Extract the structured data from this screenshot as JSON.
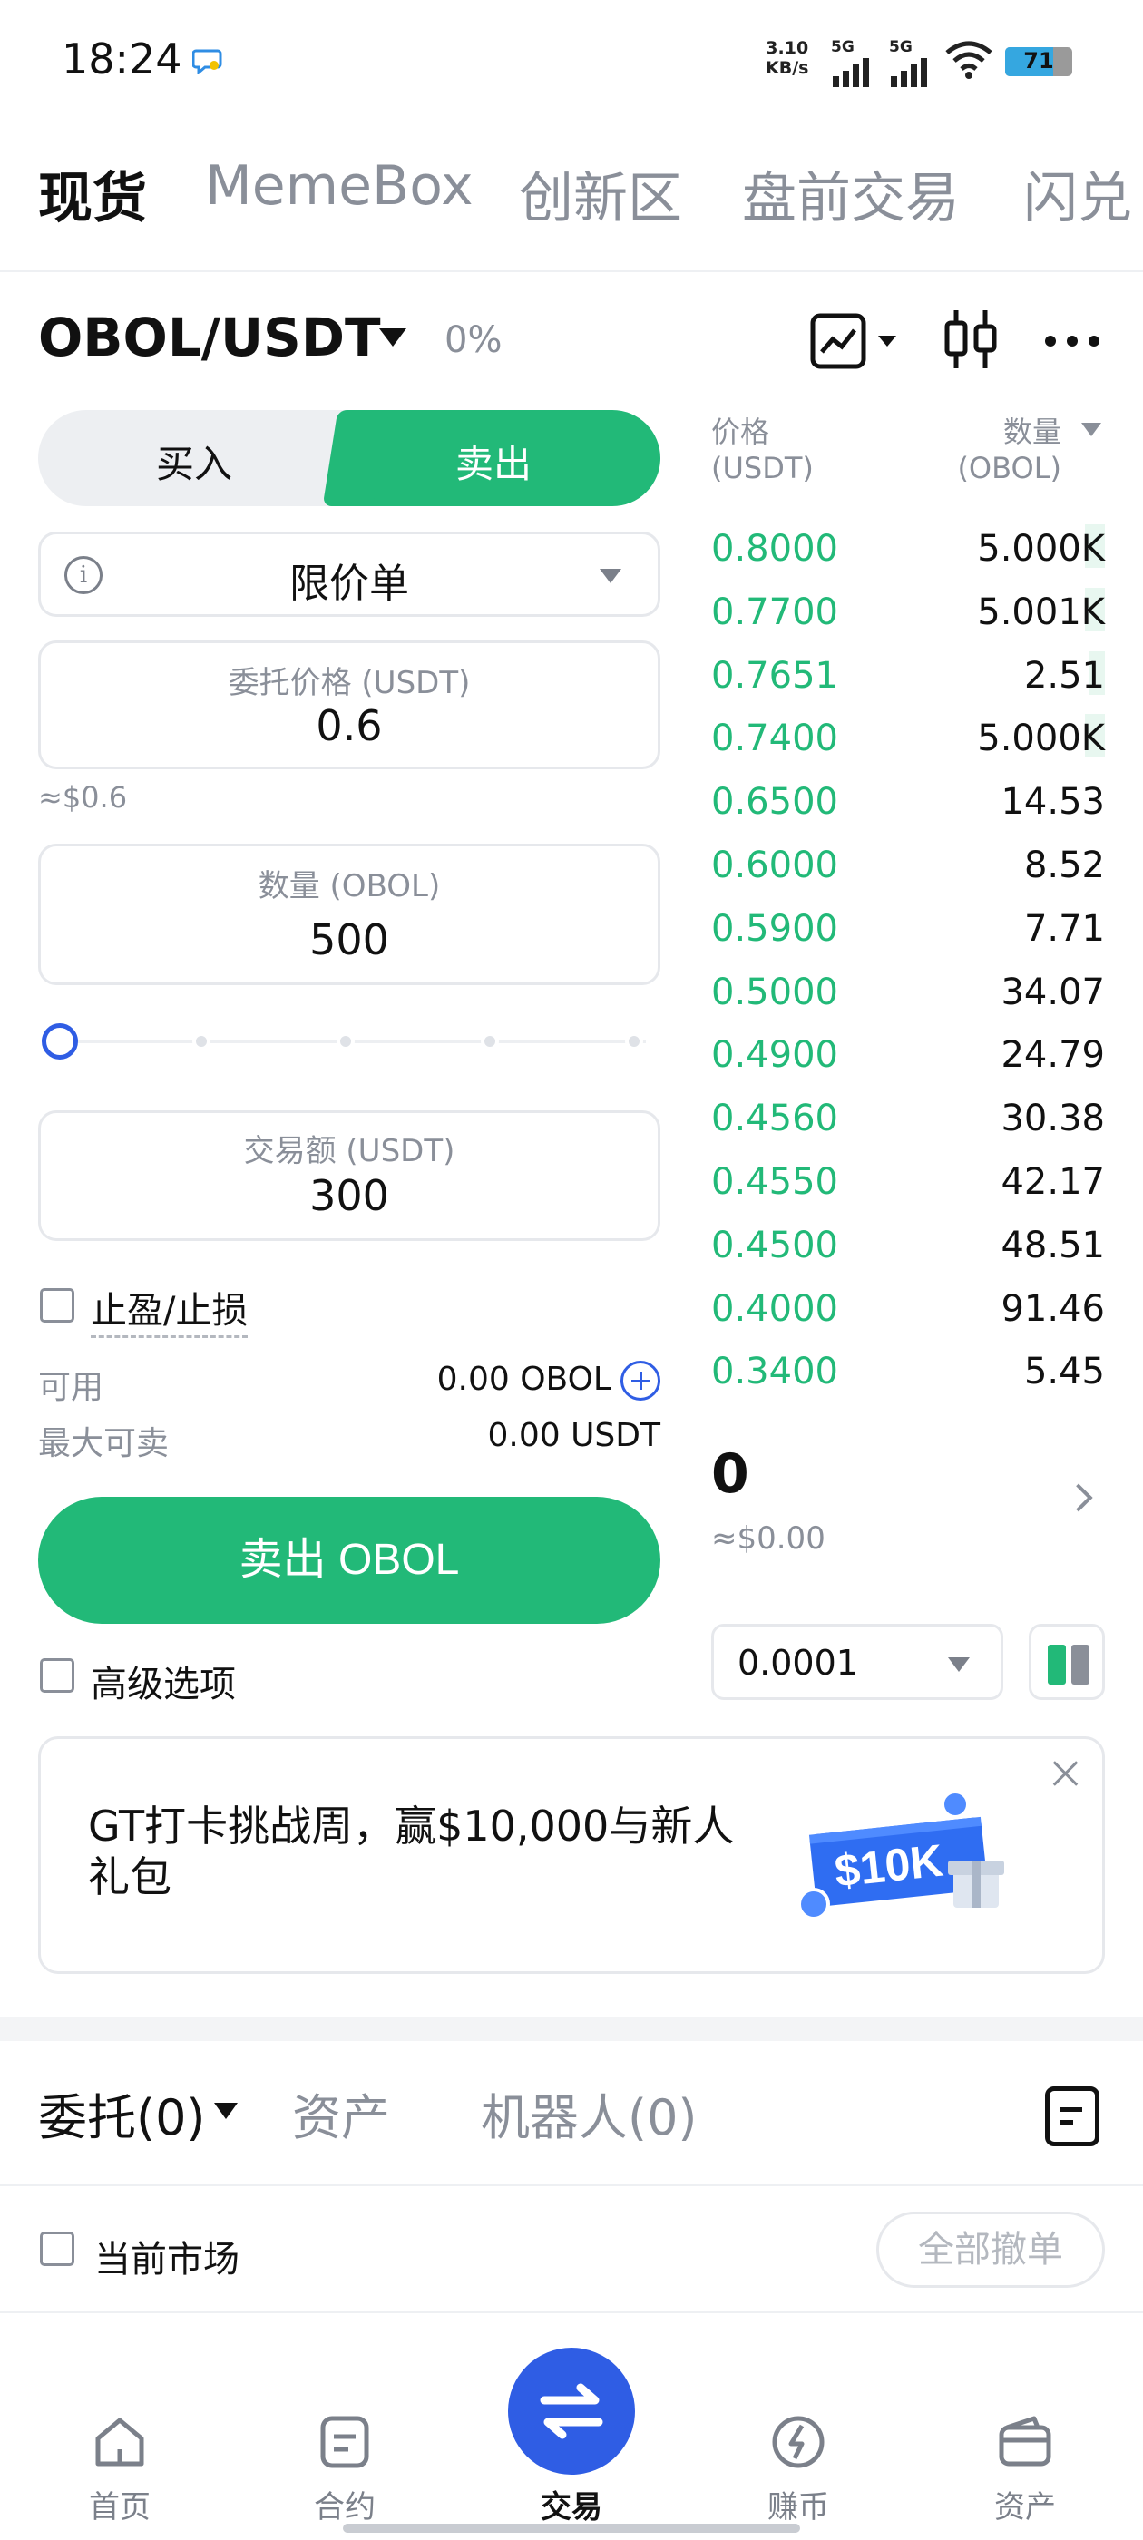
{
  "status_bar": {
    "time": "18:24",
    "net_speed_value": "3.10",
    "net_speed_unit": "KB/s",
    "sim1_label": "5G",
    "sim2_label": "5G",
    "battery": "71",
    "icons": [
      "chat-bubble-icon",
      "signal-icon",
      "wifi-icon",
      "battery-icon"
    ]
  },
  "top_tabs": [
    {
      "label": "现货",
      "active": true
    },
    {
      "label": "MemeBox",
      "active": false
    },
    {
      "label": "创新区",
      "active": false
    },
    {
      "label": "盘前交易",
      "active": false
    },
    {
      "label": "闪兑",
      "active": false
    }
  ],
  "pair": {
    "symbol": "OBOL/USDT",
    "change": "0%",
    "icons": [
      "chart-icon",
      "candlestick-icon",
      "more-icon"
    ]
  },
  "toggle": {
    "buy": "买入",
    "sell": "卖出",
    "selected": "sell"
  },
  "form": {
    "order_type": "限价单",
    "price_label": "委托价格 (USDT)",
    "price_value": "0.6",
    "price_approx": "≈$0.6",
    "qty_label": "数量 (OBOL)",
    "qty_value": "500",
    "slider_level": 0,
    "amount_label": "交易额 (USDT)",
    "amount_value": "300",
    "tpsl_label": "止盈/止损",
    "available_label": "可用",
    "available_value": "0.00 OBOL",
    "max_sell_label": "最大可卖",
    "max_sell_value": "0.00 USDT",
    "submit_label": "卖出 OBOL",
    "advanced_label": "高级选项"
  },
  "order_book": {
    "price_header_line1": "价格",
    "price_header_line2": "(USDT)",
    "qty_header_line1": "数量",
    "qty_header_line2": "(OBOL)",
    "asks": [
      {
        "price": "0.8000",
        "qty": "5.000K",
        "depth": 0.05
      },
      {
        "price": "0.7700",
        "qty": "5.001K",
        "depth": 0.05
      },
      {
        "price": "0.7651",
        "qty": "2.51",
        "depth": 0.04
      },
      {
        "price": "0.7400",
        "qty": "5.000K",
        "depth": 0.05
      },
      {
        "price": "0.6500",
        "qty": "14.53",
        "depth": 0
      },
      {
        "price": "0.6000",
        "qty": "8.52",
        "depth": 0
      },
      {
        "price": "0.5900",
        "qty": "7.71",
        "depth": 0
      },
      {
        "price": "0.5000",
        "qty": "34.07",
        "depth": 0
      },
      {
        "price": "0.4900",
        "qty": "24.79",
        "depth": 0
      },
      {
        "price": "0.4560",
        "qty": "30.38",
        "depth": 0
      },
      {
        "price": "0.4550",
        "qty": "42.17",
        "depth": 0
      },
      {
        "price": "0.4500",
        "qty": "48.51",
        "depth": 0
      },
      {
        "price": "0.4000",
        "qty": "91.46",
        "depth": 0
      },
      {
        "price": "0.3400",
        "qty": "5.45",
        "depth": 0
      }
    ],
    "last_price": "0",
    "last_price_approx": "≈$0.00",
    "precision": "0.0001"
  },
  "banner": {
    "text": "GT打卡挑战周，赢$10,000与新人礼包",
    "image_text": "$10K"
  },
  "orders": {
    "tabs": [
      {
        "label": "委托(0)",
        "active": true
      },
      {
        "label": "资产",
        "active": false
      },
      {
        "label": "机器人(0)",
        "active": false
      }
    ],
    "current_market_label": "当前市场",
    "cancel_all_label": "全部撤单"
  },
  "bottom_nav": [
    {
      "label": "首页",
      "icon": "home-icon",
      "active": false
    },
    {
      "label": "合约",
      "icon": "contract-icon",
      "active": false
    },
    {
      "label": "交易",
      "icon": "trade-icon",
      "active": true
    },
    {
      "label": "赚币",
      "icon": "earn-icon",
      "active": false
    },
    {
      "label": "资产",
      "icon": "wallet-icon",
      "active": false
    }
  ],
  "colors": {
    "green": "#22b978",
    "blue": "#2f5de4",
    "grey_text": "#8a8f99",
    "border": "#e6e8ec"
  }
}
